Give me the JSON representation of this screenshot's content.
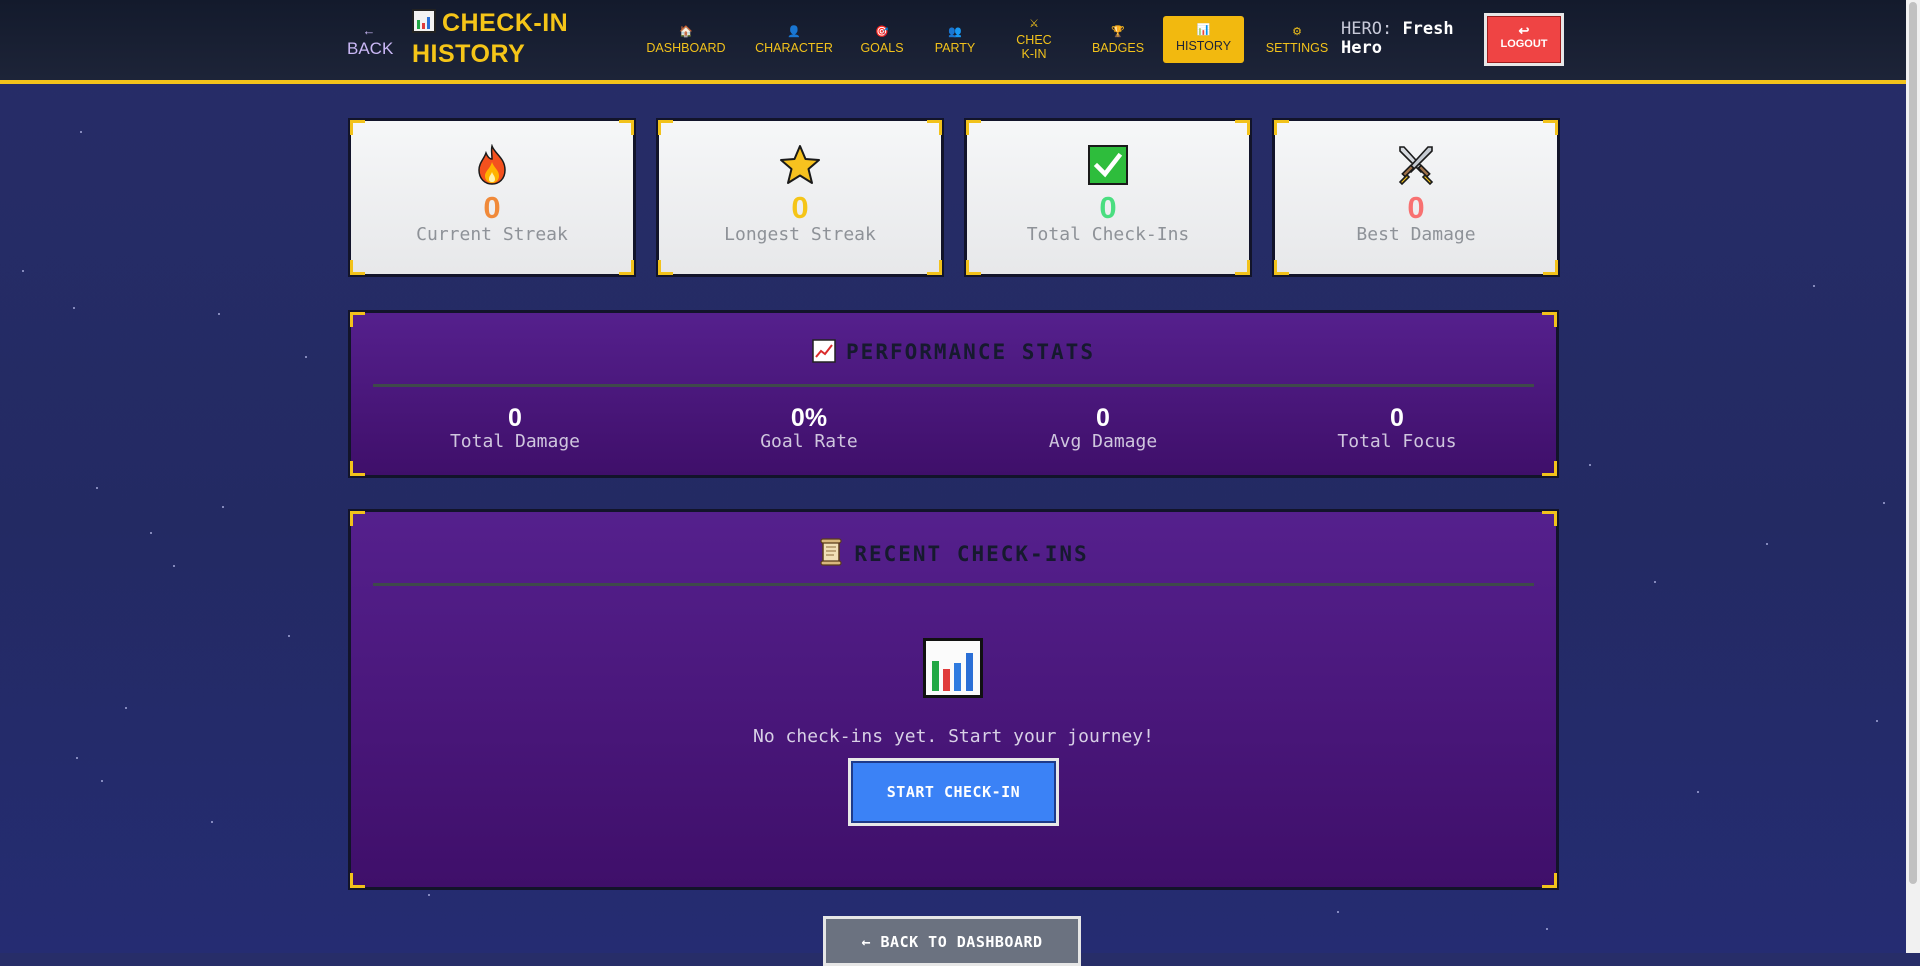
{
  "header": {
    "back_arrow": "←",
    "back_label": "BACK",
    "title": "CHECK-IN HISTORY",
    "nav": [
      {
        "label": "DASHBOARD",
        "icon": "house-icon",
        "glyph": "🏠"
      },
      {
        "label": "CHARACTER",
        "icon": "character-icon",
        "glyph": "👤"
      },
      {
        "label": "GOALS",
        "icon": "target-icon",
        "glyph": "🎯"
      },
      {
        "label": "PARTY",
        "icon": "party-icon",
        "glyph": "👥"
      },
      {
        "label": "CHECK-IN",
        "icon": "swords-icon",
        "glyph": "⚔"
      },
      {
        "label": "BADGES",
        "icon": "trophy-icon",
        "glyph": "🏆"
      },
      {
        "label": "HISTORY",
        "icon": "chart-icon",
        "glyph": "📊",
        "active": true
      },
      {
        "label": "SETTINGS",
        "icon": "gear-icon",
        "glyph": "⚙"
      }
    ],
    "hero_key": "HERO:",
    "hero_name": "Fresh Hero",
    "logout_glyph": "↩",
    "logout_label": "LOGOUT"
  },
  "stats": [
    {
      "icon": "fire-icon",
      "value": "0",
      "label": "Current Streak",
      "color": "#f08a3a"
    },
    {
      "icon": "star-icon",
      "value": "0",
      "label": "Longest Streak",
      "color": "#f5c518"
    },
    {
      "icon": "checkmark-icon",
      "value": "0",
      "label": "Total Check-Ins",
      "color": "#4ade80"
    },
    {
      "icon": "crossed-swords-icon",
      "value": "0",
      "label": "Best Damage",
      "color": "#f87171"
    }
  ],
  "performance": {
    "title": "PERFORMANCE STATS",
    "icon": "line-chart-icon",
    "items": [
      {
        "value": "0",
        "label": "Total Damage"
      },
      {
        "value": "0%",
        "label": "Goal Rate"
      },
      {
        "value": "0",
        "label": "Avg Damage"
      },
      {
        "value": "0",
        "label": "Total Focus"
      }
    ]
  },
  "recent": {
    "title": "RECENT CHECK-INS",
    "icon": "scroll-icon",
    "empty_icon": "bar-chart-icon",
    "empty_text": "No check-ins yet. Start your journey!",
    "start_button": "START CHECK-IN"
  },
  "footer": {
    "back_button": "← BACK TO DASHBOARD"
  },
  "colors": {
    "accent": "#f2c21b",
    "panel": "#4a1680",
    "logout": "#ef4444",
    "primary_button": "#3b82f6",
    "secondary_button": "#6b7280"
  }
}
